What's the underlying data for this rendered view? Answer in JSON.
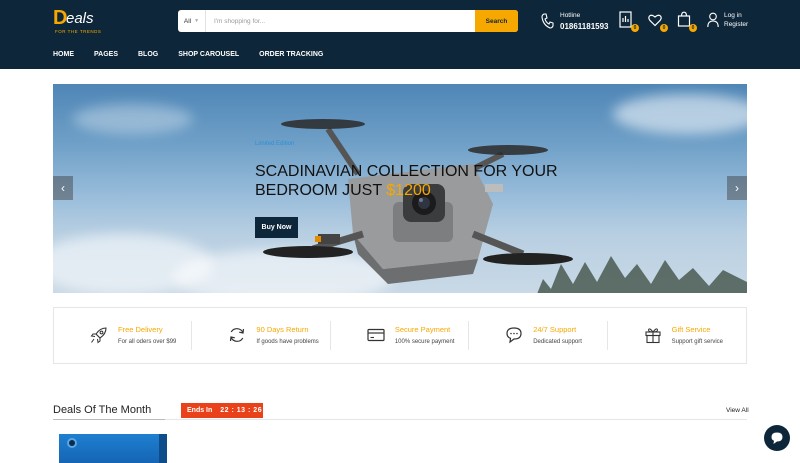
{
  "brand": {
    "logo_mark": "D",
    "logo_word": "eals",
    "tagline": "FOR THE TRENDS"
  },
  "search": {
    "category": "All",
    "placeholder": "I'm shopping for...",
    "button_label": "Search"
  },
  "hotline": {
    "label": "Hotline",
    "number": "01861181593"
  },
  "header_icons": {
    "compare_count": "0",
    "wishlist_count": "0",
    "cart_count": "0",
    "login_label": "Log in",
    "register_label": "Register"
  },
  "nav": {
    "items": [
      "HOME",
      "PAGES",
      "BLOG",
      "SHOP CAROUSEL",
      "ORDER TRACKING"
    ]
  },
  "hero": {
    "kicker": "Limited Edition",
    "title_line1": "SCADINAVIAN COLLECTION FOR YOUR",
    "title_line2_prefix": "BEDROOM JUST ",
    "price": "$1200",
    "button_label": "Buy Now",
    "prev_glyph": "‹",
    "next_glyph": "›"
  },
  "features": [
    {
      "icon": "rocket-icon",
      "title": "Free Delivery",
      "subtitle": "For all oders over $99"
    },
    {
      "icon": "refresh-icon",
      "title": "90 Days Return",
      "subtitle": "If goods have problems"
    },
    {
      "icon": "credit-card-icon",
      "title": "Secure Payment",
      "subtitle": "100% secure payment"
    },
    {
      "icon": "chat-support-icon",
      "title": "24/7 Support",
      "subtitle": "Dedicated support"
    },
    {
      "icon": "gift-icon",
      "title": "Gift Service",
      "subtitle": "Support gift service"
    }
  ],
  "deals": {
    "title": "Deals Of The Month",
    "ends_label": "Ends In",
    "countdown": "22 : 13 : 26",
    "view_all": "View All"
  },
  "colors": {
    "header_bg": "#0e2639",
    "accent": "#f6a800",
    "countdown_bg": "#e9421b"
  }
}
